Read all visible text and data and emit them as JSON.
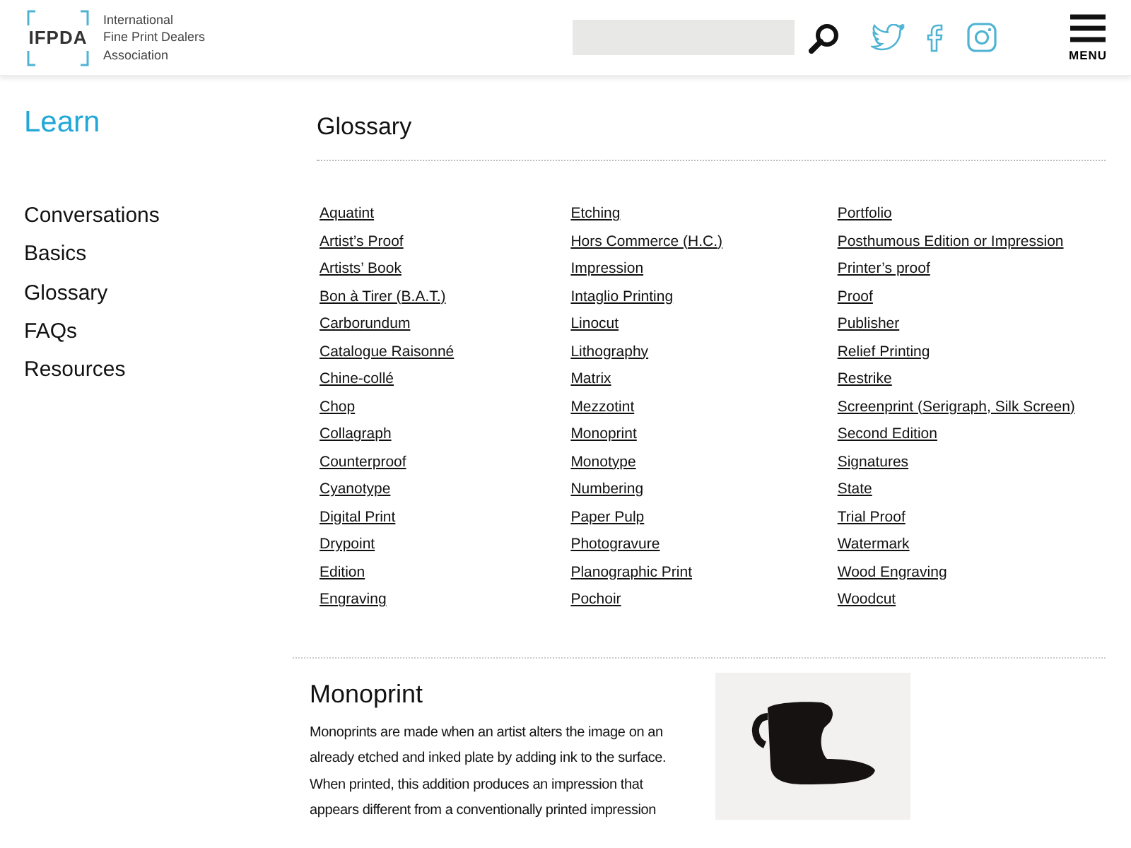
{
  "header": {
    "logo": {
      "mark": "IFPDA",
      "name_lines": [
        "International",
        "Fine Print Dealers",
        "Association"
      ]
    },
    "menu_label": "MENU"
  },
  "sidebar": {
    "heading": "Learn",
    "items": [
      "Conversations",
      "Basics",
      "Glossary",
      "FAQs",
      "Resources"
    ]
  },
  "glossary": {
    "title": "Glossary",
    "columns": [
      [
        "Aquatint",
        "Artist’s Proof",
        "Artists’ Book",
        "Bon à Tirer (B.A.T.)",
        "Carborundum",
        "Catalogue Raisonné",
        "Chine-collé",
        "Chop",
        "Collagraph",
        "Counterproof",
        "Cyanotype",
        "Digital Print",
        "Drypoint",
        "Edition",
        "Engraving"
      ],
      [
        "Etching",
        "Hors Commerce (H.C.)",
        "Impression",
        "Intaglio Printing",
        "Linocut",
        "Lithography",
        "Matrix",
        "Mezzotint",
        "Monoprint",
        "Monotype",
        "Numbering",
        "Paper Pulp",
        "Photogravure",
        "Planographic Print",
        "Pochoir"
      ],
      [
        "Portfolio",
        "Posthumous Edition or Impression",
        "Printer’s proof",
        "Proof",
        "Publisher",
        "Relief Printing",
        "Restrike",
        "Screenprint (Serigraph, Silk Screen)",
        "Second Edition",
        "Signatures",
        "State",
        "Trial Proof",
        "Watermark",
        "Wood Engraving",
        "Woodcut"
      ]
    ]
  },
  "entry": {
    "title": "Monoprint",
    "text": "Monoprints are made when an artist alters the image on an already etched and inked plate by adding ink to the surface. When printed, this addition produces an impression that appears different from a conventionally printed impression"
  }
}
